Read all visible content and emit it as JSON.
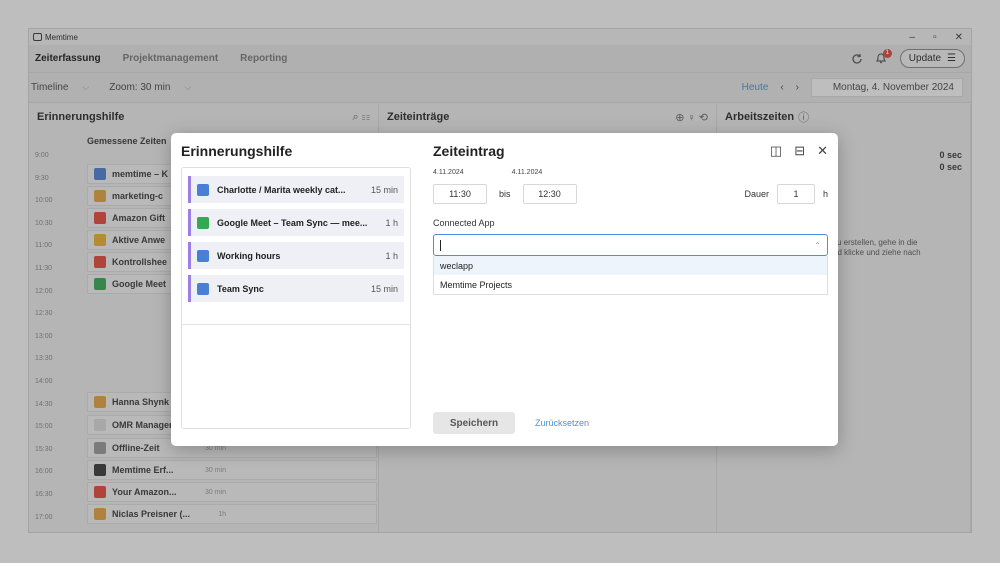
{
  "window": {
    "title": "Memtime",
    "controls": [
      "–",
      "▫",
      "✕"
    ]
  },
  "menu": {
    "tabs": [
      "Zeiterfassung",
      "Projektmanagement",
      "Reporting"
    ],
    "notifications": "1",
    "update_label": "Update"
  },
  "toolbar": {
    "view": "Timeline",
    "zoom": "Zoom: 30 min",
    "today": "Heute",
    "date": "Montag, 4. November 2024"
  },
  "panes": {
    "left_title": "Erinnerungshilfe",
    "left_sub": "Gemessene Zeiten",
    "mid_title": "Zeiteinträge",
    "right_title": "Arbeitszeiten",
    "right_values": [
      "0 sec",
      "0 sec"
    ],
    "right_hint_1": "zu erstellen, gehe in die",
    "right_hint_2": "nd klicke und ziehe nach"
  },
  "timeline": {
    "times": [
      "9:00",
      "9:30",
      "10:00",
      "10:30",
      "11:00",
      "11:30",
      "12:00",
      "12:30",
      "13:00",
      "13:30",
      "14:00",
      "14:30",
      "15:00",
      "15:30",
      "16:00",
      "16:30",
      "17:00"
    ],
    "bg_items": [
      {
        "label": "memtime – K",
        "dur": ""
      },
      {
        "label": "marketing-c",
        "dur": ""
      },
      {
        "label": "Amazon Gift",
        "dur": ""
      },
      {
        "label": "Aktive Anwe",
        "dur": ""
      },
      {
        "label": "Kontrollshee",
        "dur": ""
      },
      {
        "label": "Google Meet",
        "dur": ""
      },
      {
        "label": "Hanna Shynk",
        "dur": ""
      },
      {
        "label": "OMR Manager —",
        "dur": ""
      },
      {
        "label": "Offline-Zeit",
        "dur": "30 min"
      },
      {
        "label": "Memtime Erf...",
        "dur": "30 min"
      },
      {
        "label": "Your Amazon...",
        "dur": "30 min"
      },
      {
        "label": "Niclas Preisner (...",
        "dur": "1h"
      }
    ]
  },
  "modal": {
    "left_title": "Erinnerungshilfe",
    "entries": [
      {
        "label": "Charlotte / Marita weekly cat...",
        "dur": "15 min"
      },
      {
        "label": "Google Meet – Team Sync — mee...",
        "dur": "1 h"
      },
      {
        "label": "Working hours",
        "dur": "1 h"
      },
      {
        "label": "Team Sync",
        "dur": "15 min"
      }
    ],
    "right_title": "Zeiteintrag",
    "date_from": "4.11.2024",
    "date_to": "4.11.2024",
    "time_from": "11:30",
    "bis": "bis",
    "time_to": "12:30",
    "dauer_label": "Dauer",
    "dauer_value": "1",
    "dauer_unit": "h",
    "connected_app_label": "Connected App",
    "options": [
      "weclapp",
      "Memtime Projects"
    ],
    "save_label": "Speichern",
    "reset_label": "Zurücksetzen"
  }
}
